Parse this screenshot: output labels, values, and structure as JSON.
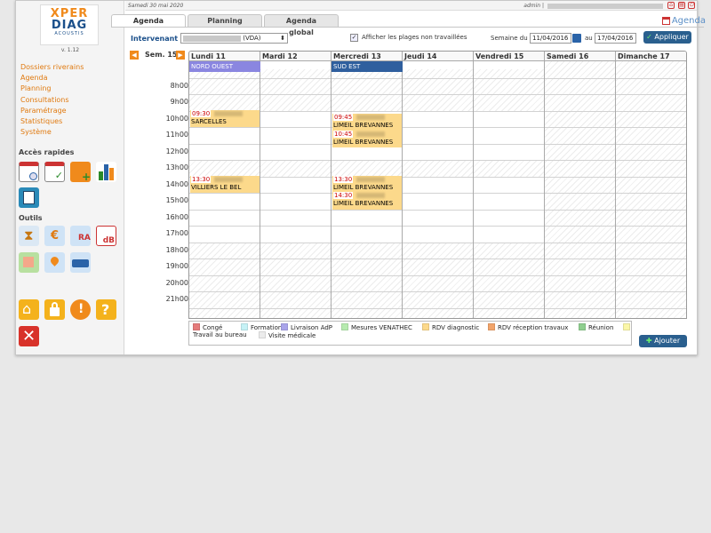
{
  "topbar": {
    "date": "Samedi 30 mai 2020",
    "user": "admin |"
  },
  "logo": {
    "line1": "XPER",
    "line2": "DIAG",
    "line3": "ACOUSTIS",
    "version": "v. 1.12"
  },
  "sidebar": {
    "nav": [
      "Dossiers riverains",
      "Agenda",
      "Planning",
      "Consultations",
      "Paramétrage",
      "Statistiques",
      "Système"
    ],
    "quick_title": "Accès rapides",
    "tools_title": "Outils"
  },
  "tabs": [
    "Agenda",
    "Planning",
    "Agenda global"
  ],
  "top_link": "Agenda",
  "filter": {
    "intervenant_label": "Intervenant :",
    "intervenant_value": "(VDA)",
    "checkbox_label": "Afficher les plages non travaillées",
    "week_label": "Semaine du",
    "date_from": "11/04/2016",
    "au_label": "au",
    "date_to": "17/04/2016",
    "apply": "Appliquer"
  },
  "calendar": {
    "week": "Sem. 15",
    "days": [
      "Lundi 11",
      "Mardi 12",
      "Mercredi 13",
      "Jeudi 14",
      "Vendredi 15",
      "Samedi 16",
      "Dimanche 17"
    ],
    "hours": [
      "8h00",
      "9h00",
      "10h00",
      "11h00",
      "12h00",
      "13h00",
      "14h00",
      "15h00",
      "16h00",
      "17h00",
      "18h00",
      "19h00",
      "20h00",
      "21h00"
    ],
    "zones": [
      {
        "day": 0,
        "label": "NORD OUEST",
        "color": "#8a86e0"
      },
      {
        "day": 2,
        "label": "SUD EST",
        "color": "#2f5f9e"
      }
    ],
    "events": [
      {
        "day": 0,
        "time": "09:30",
        "place": "SARCELLES"
      },
      {
        "day": 0,
        "time": "13:30",
        "place": "VILLIERS LE BEL"
      },
      {
        "day": 2,
        "time": "09:45",
        "place": "LIMEIL BREVANNES"
      },
      {
        "day": 2,
        "time": "10:45",
        "place": "LIMEIL BREVANNES"
      },
      {
        "day": 2,
        "time": "13:30",
        "place": "LIMEIL BREVANNES"
      },
      {
        "day": 2,
        "time": "14:30",
        "place": "LIMEIL BREVANNES"
      }
    ]
  },
  "legend": [
    {
      "label": "Congé",
      "color": "#e57b7b"
    },
    {
      "label": "Formation",
      "color": "#c6f2f6"
    },
    {
      "label": "Livraison AdP",
      "color": "#a9a4ea"
    },
    {
      "label": "Mesures VENATHEC",
      "color": "#b7ebb0"
    },
    {
      "label": "RDV diagnostic",
      "color": "#fcd98b"
    },
    {
      "label": "RDV réception travaux",
      "color": "#f2a46a"
    },
    {
      "label": "Réunion",
      "color": "#8fcf8f"
    },
    {
      "label": "Travail au bureau",
      "color": "#fbf7a8"
    },
    {
      "label": "Visite médicale",
      "color": "#ececec"
    }
  ],
  "add_button": "Ajouter"
}
